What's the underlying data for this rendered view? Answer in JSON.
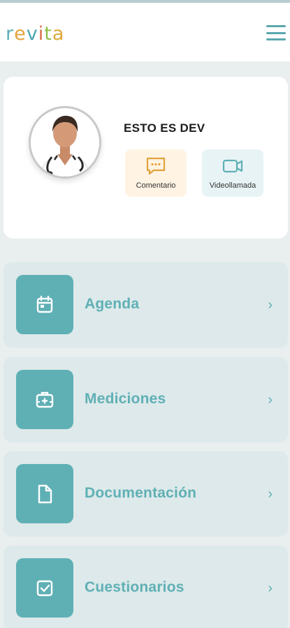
{
  "brand": {
    "logo_letters": [
      "r",
      "e",
      "v",
      "i",
      "t",
      "a"
    ],
    "logo_colors": [
      "#5ab0b6",
      "#e2a23a",
      "#4aa6b3",
      "#d96b4b",
      "#8fbf4a",
      "#e0a83a"
    ]
  },
  "header": {
    "menu_icon": "hamburger-icon"
  },
  "profile": {
    "name": "ESTO ES DEV",
    "actions": [
      {
        "label": "Comentario",
        "icon": "chat-icon"
      },
      {
        "label": "Videollamada",
        "icon": "video-camera-icon"
      }
    ]
  },
  "menu": [
    {
      "label": "Agenda",
      "icon": "calendar-icon"
    },
    {
      "label": "Mediciones",
      "icon": "medical-kit-icon"
    },
    {
      "label": "Documentación",
      "icon": "document-icon"
    },
    {
      "label": "Cuestionarios",
      "icon": "checkbox-icon"
    }
  ],
  "colors": {
    "accent": "#5fb0b5",
    "card": "#dde9ea",
    "background": "#e9eeef",
    "comment_bg": "#fff3e3",
    "video_bg": "#e8f3f5"
  }
}
